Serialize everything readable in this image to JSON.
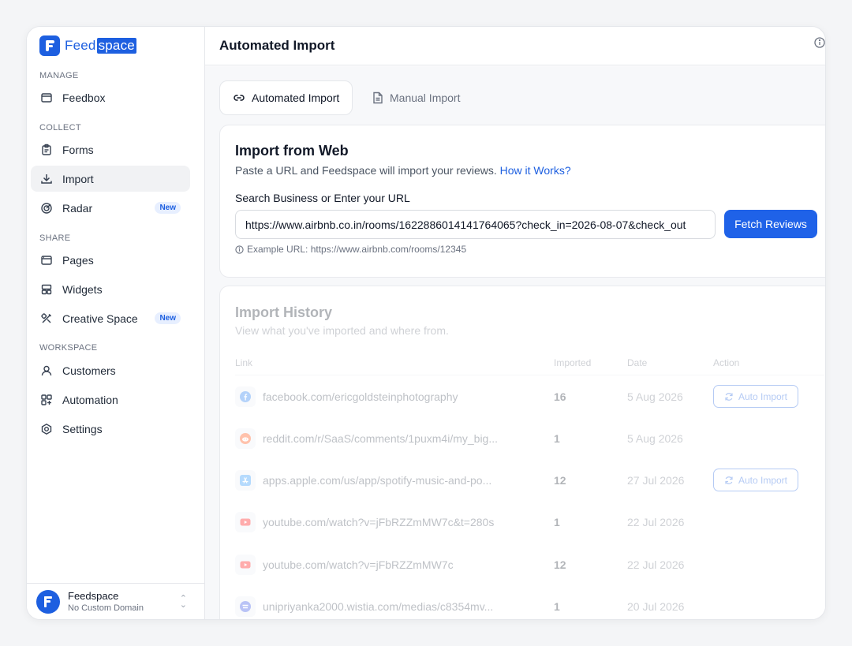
{
  "brand": {
    "name_part1": "Feed",
    "name_part2": "space"
  },
  "sidebar": {
    "sections": {
      "manage": "MANAGE",
      "collect": "COLLECT",
      "share": "SHARE",
      "workspace": "WORKSPACE"
    },
    "items": {
      "feedbox": "Feedbox",
      "forms": "Forms",
      "import": "Import",
      "radar": "Radar",
      "pages": "Pages",
      "widgets": "Widgets",
      "creative_space": "Creative Space",
      "customers": "Customers",
      "automation": "Automation",
      "settings": "Settings"
    },
    "badge_new": "New",
    "workspace": {
      "name": "Feedspace",
      "domain": "No Custom Domain"
    }
  },
  "header": {
    "title": "Automated Import"
  },
  "tabs": {
    "automated": "Automated Import",
    "manual": "Manual Import"
  },
  "import_web": {
    "title": "Import from Web",
    "subtitle": "Paste a URL and Feedspace will import your reviews.",
    "how_link": "How it Works?",
    "field_label": "Search Business or Enter your URL",
    "url_value": "https://www.airbnb.co.in/rooms/1622886014141764065?check_in=2026-08-07&check_out",
    "fetch_label": "Fetch Reviews",
    "example": "Example URL: https://www.airbnb.com/rooms/12345"
  },
  "history": {
    "title": "Import History",
    "subtitle": "View what you've imported and where from.",
    "columns": {
      "link": "Link",
      "imported": "Imported",
      "date": "Date",
      "action": "Action"
    },
    "auto_import_label": "Auto Import",
    "rows": [
      {
        "source_icon": "facebook-icon",
        "link": "facebook.com/ericgoldsteinphotography",
        "imported": "16",
        "date": "5 Aug 2026",
        "action": "Auto Import"
      },
      {
        "source_icon": "reddit-icon",
        "link": "reddit.com/r/SaaS/comments/1puxm4i/my_big...",
        "imported": "1",
        "date": "5 Aug 2026",
        "action": ""
      },
      {
        "source_icon": "app-store-icon",
        "link": "apps.apple.com/us/app/spotify-music-and-po...",
        "imported": "12",
        "date": "27 Jul 2026",
        "action": "Auto Import"
      },
      {
        "source_icon": "youtube-icon",
        "link": "youtube.com/watch?v=jFbRZZmMW7c&t=280s",
        "imported": "1",
        "date": "22 Jul 2026",
        "action": ""
      },
      {
        "source_icon": "youtube-icon",
        "link": "youtube.com/watch?v=jFbRZZmMW7c",
        "imported": "12",
        "date": "22 Jul 2026",
        "action": ""
      },
      {
        "source_icon": "wistia-icon",
        "link": "unipriyanka2000.wistia.com/medias/c8354mv...",
        "imported": "1",
        "date": "20 Jul 2026",
        "action": ""
      }
    ]
  },
  "colors": {
    "brand": "#1d5fe0",
    "button": "#1f62e8"
  }
}
